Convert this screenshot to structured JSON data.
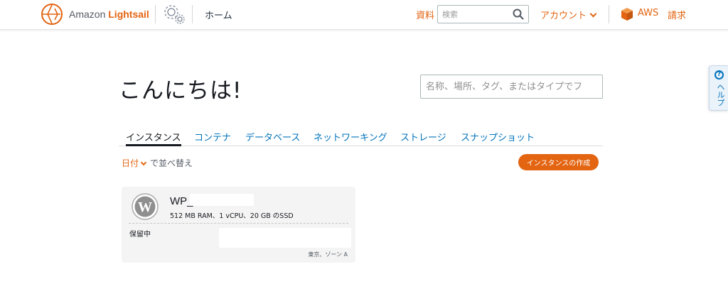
{
  "header": {
    "logo_prefix": "Amazon",
    "logo_accent": "Lightsail",
    "home_label": "ホーム",
    "docs_label": "資料",
    "search_placeholder": "検索",
    "account_label": "アカウント",
    "aws_label": "AWS",
    "billing_label": "請求"
  },
  "help": {
    "label": "ヘルプ"
  },
  "main": {
    "greeting": "こんにちは!",
    "filter_placeholder": "名称、場所、タグ、またはタイプでフ",
    "tabs": [
      {
        "label": "インスタンス",
        "active": true
      },
      {
        "label": "コンテナ"
      },
      {
        "label": "データベース"
      },
      {
        "label": "ネットワーキング"
      },
      {
        "label": "ストレージ"
      },
      {
        "label": "スナップショット"
      }
    ],
    "sort": {
      "field": "日付",
      "suffix": "で並べ替え"
    },
    "create_button": "インスタンスの作成"
  },
  "instance": {
    "name_prefix": "WP_",
    "specs": "512 MB RAM、1 vCPU、20 GB のSSD",
    "status": "保留中",
    "zone": "東京、ゾーン A"
  },
  "colors": {
    "accent": "#e36411",
    "link": "#0073bb",
    "card_bg": "#f4f4f4"
  },
  "icons": [
    "lightsail-logo-icon",
    "gear-icon",
    "search-icon",
    "chevron-down-icon",
    "aws-cube-icon",
    "help-icon",
    "wordpress-icon"
  ]
}
